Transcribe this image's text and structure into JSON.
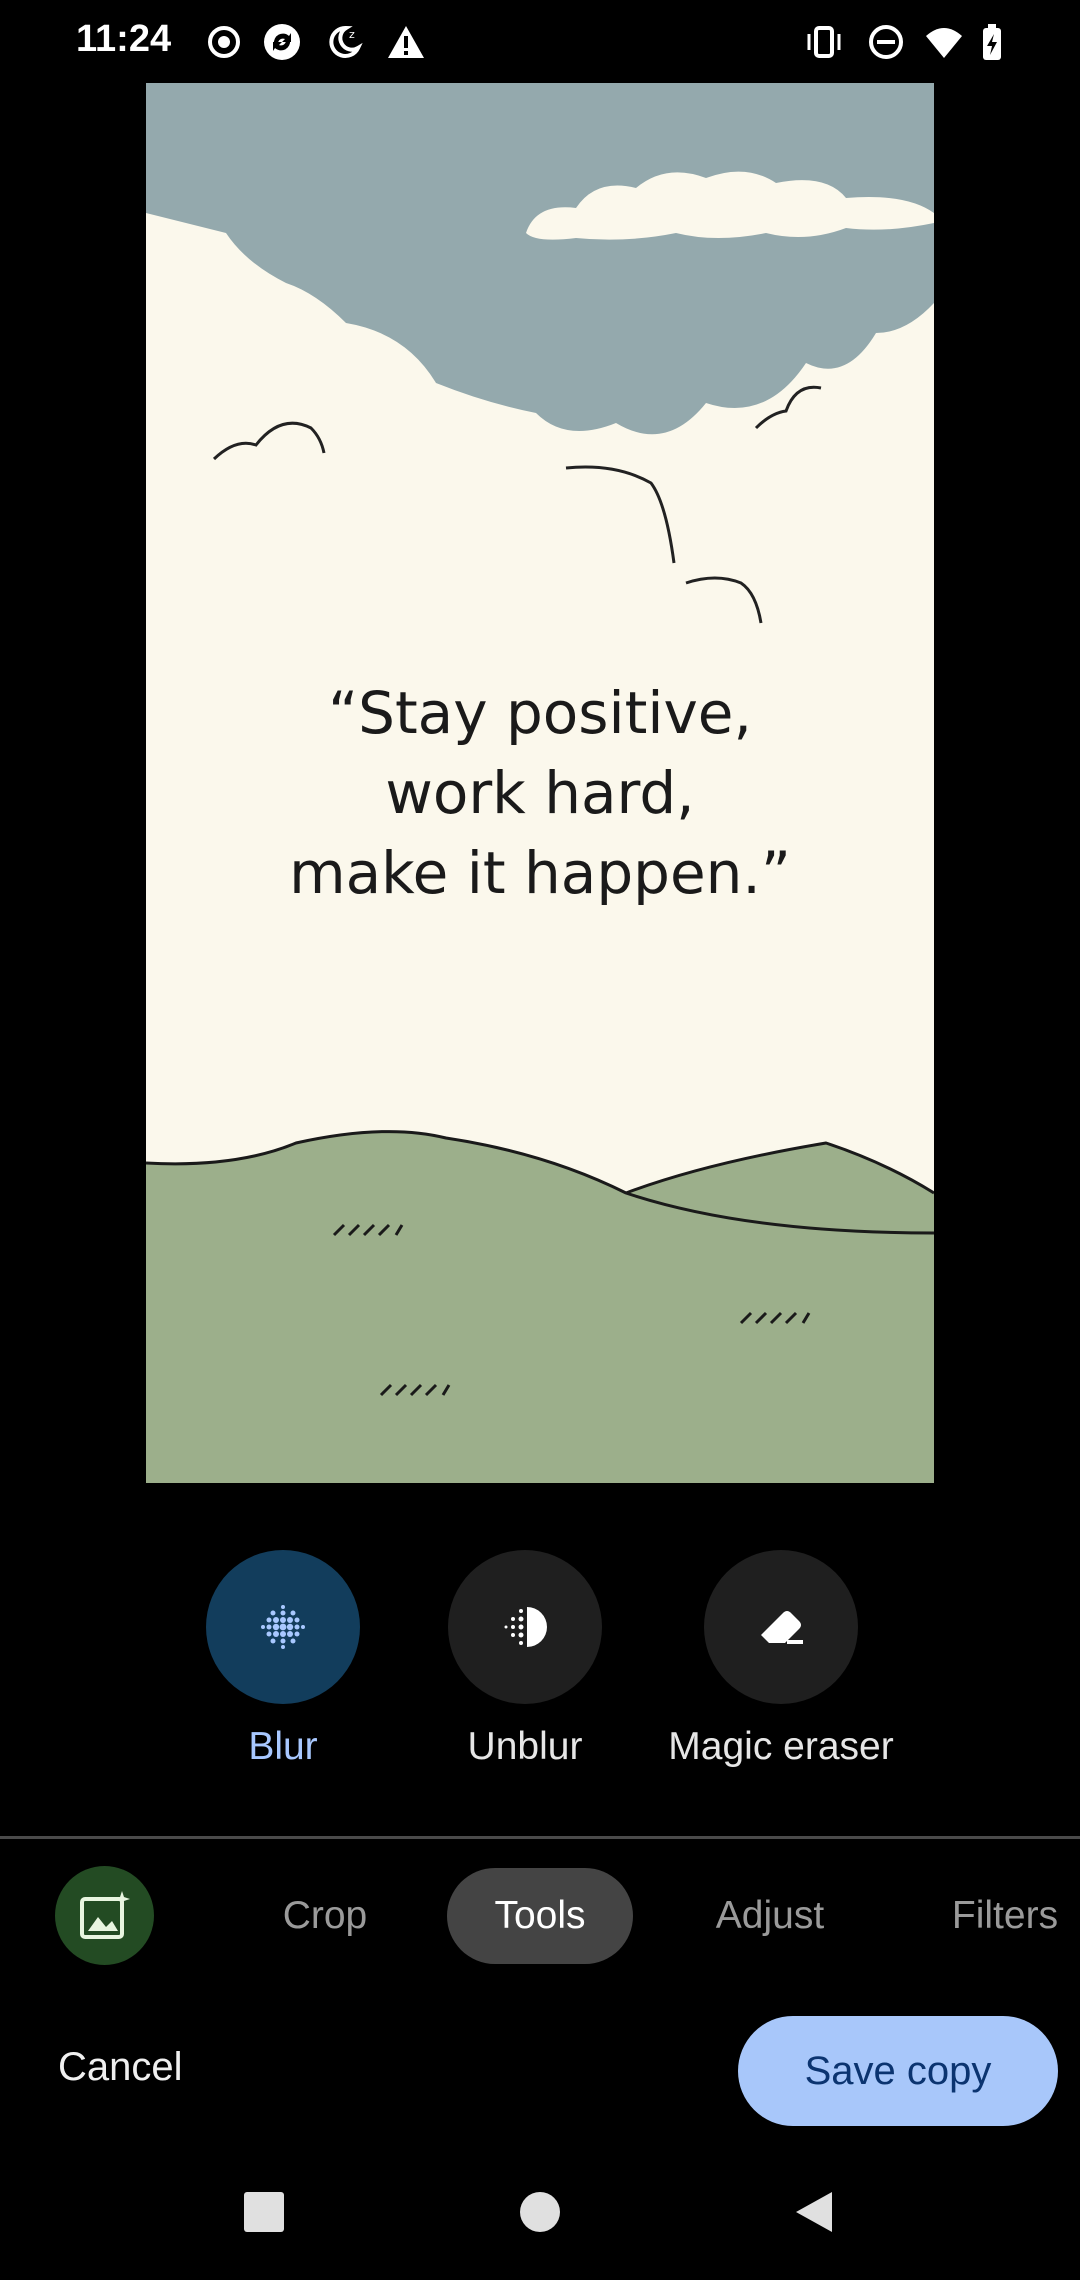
{
  "status_bar": {
    "time": "11:24",
    "left_icons": [
      "record-icon",
      "sync-icon",
      "do-not-disturb-moon-icon",
      "warning-icon"
    ],
    "right_icons": [
      "vibrate-icon",
      "dnd-icon",
      "wifi-icon",
      "battery-charging-icon"
    ]
  },
  "photo": {
    "quote_line1": "“Stay positive,",
    "quote_line2": "work hard,",
    "quote_line3": "make it happen.”"
  },
  "tools": {
    "items": [
      {
        "label": "Blur",
        "icon": "blur-icon",
        "active": true
      },
      {
        "label": "Unblur",
        "icon": "unblur-icon",
        "active": false
      },
      {
        "label": "Magic eraser",
        "icon": "eraser-icon",
        "active": false
      }
    ]
  },
  "tabs": {
    "items": [
      {
        "label": "Crop",
        "active": false
      },
      {
        "label": "Tools",
        "active": true
      },
      {
        "label": "Adjust",
        "active": false
      },
      {
        "label": "Filters",
        "active": false
      }
    ]
  },
  "actions": {
    "cancel_label": "Cancel",
    "save_label": "Save copy"
  },
  "nav": {
    "icons": [
      "recents-icon",
      "home-icon",
      "back-icon"
    ]
  },
  "colors": {
    "accent": "#a8c7fa",
    "active_tool": "#123d5c",
    "sky": "#94a9ad",
    "cream": "#fbf8ec",
    "hills": "#9caf8b"
  }
}
